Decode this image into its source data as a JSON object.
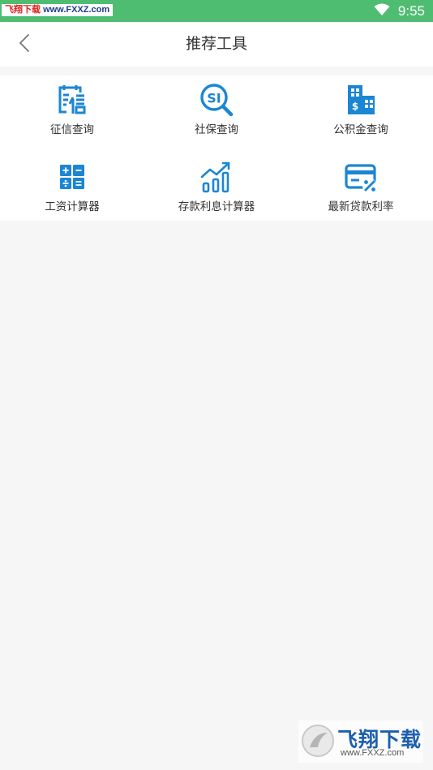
{
  "status_bar": {
    "watermark_part1": "飞翔下载",
    "watermark_part2": "www.FXXZ.com",
    "time": "9:55",
    "bg_color": "#4ebd72"
  },
  "header": {
    "title": "推荐工具",
    "back_icon": "chevron-left-icon"
  },
  "accent_color": "#1b86d4",
  "tools": [
    {
      "label": "征信查询",
      "icon": "credit-report-icon"
    },
    {
      "label": "社保查询",
      "icon": "social-security-search-icon"
    },
    {
      "label": "公积金查询",
      "icon": "housing-fund-building-icon"
    },
    {
      "label": "工资计算器",
      "icon": "calculator-icon"
    },
    {
      "label": "存款利息计算器",
      "icon": "growth-chart-icon"
    },
    {
      "label": "最新贷款利率",
      "icon": "card-percent-icon"
    }
  ],
  "bottom_watermark": {
    "brand": "飞翔下载",
    "url": "www.FXXZ.com"
  }
}
